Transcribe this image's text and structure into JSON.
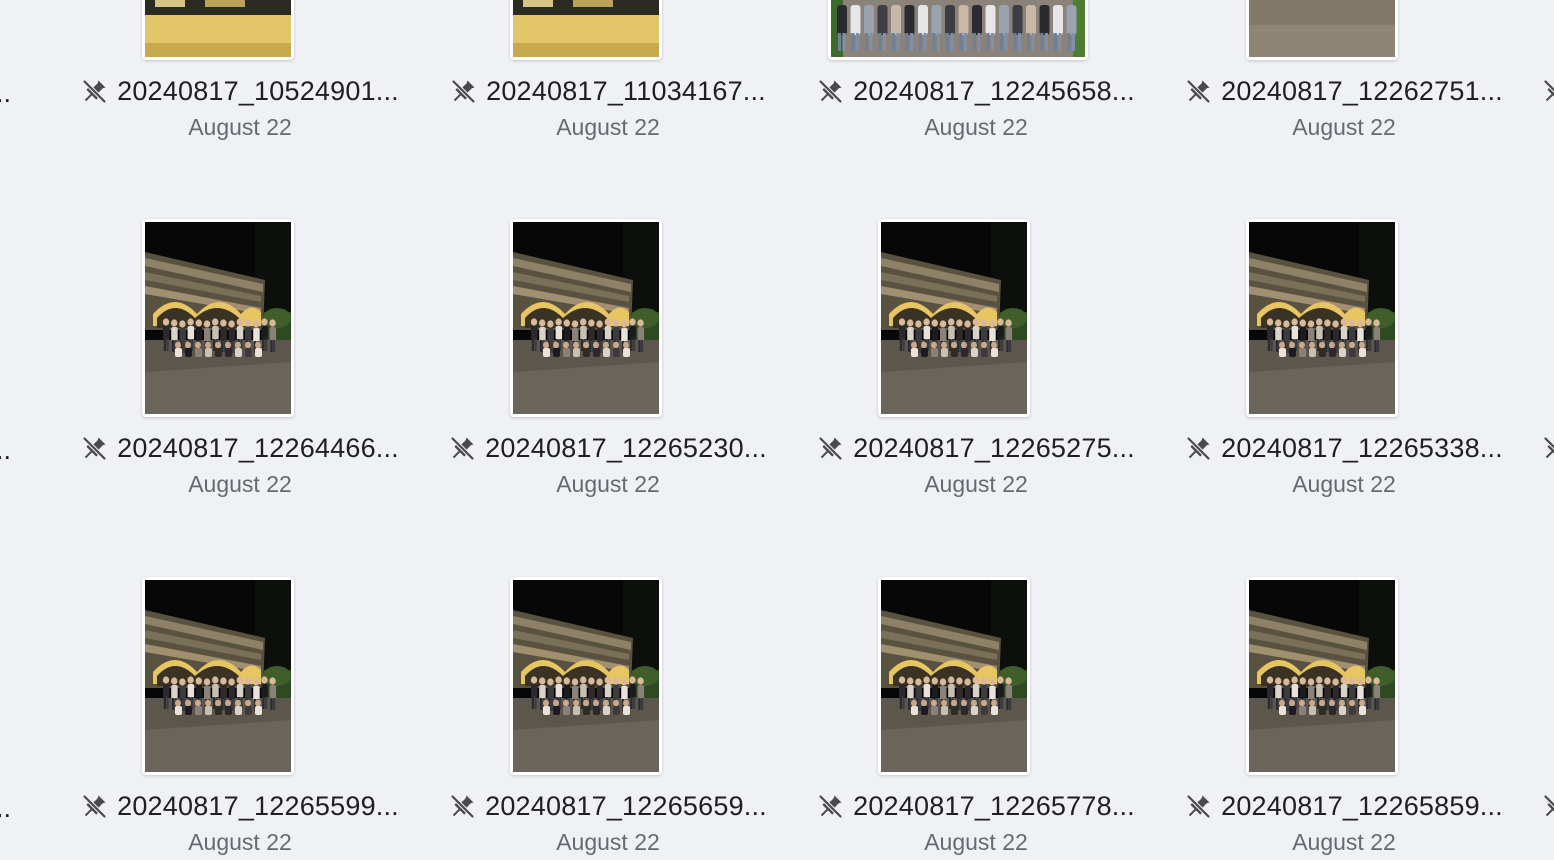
{
  "app": {
    "view": "file-browser-thumbnail-grid"
  },
  "grid": {
    "rows": [
      {
        "items": [
          {
            "name": "20240817_10524901...",
            "date": "August 22",
            "thumb": "building-night"
          },
          {
            "name": "20240817_11034167...",
            "date": "August 22",
            "thumb": "building-night"
          },
          {
            "name": "20240817_12245658...",
            "date": "August 22",
            "thumb": "group-day"
          },
          {
            "name": "20240817_12262751...",
            "date": "August 22",
            "thumb": "pavement"
          }
        ]
      },
      {
        "items": [
          {
            "name": "20240817_12264466...",
            "date": "August 22",
            "thumb": "group-night"
          },
          {
            "name": "20240817_12265230...",
            "date": "August 22",
            "thumb": "group-night"
          },
          {
            "name": "20240817_12265275...",
            "date": "August 22",
            "thumb": "group-night"
          },
          {
            "name": "20240817_12265338...",
            "date": "August 22",
            "thumb": "group-night"
          }
        ]
      },
      {
        "items": [
          {
            "name": "20240817_12265599...",
            "date": "August 22",
            "thumb": "group-night"
          },
          {
            "name": "20240817_12265659...",
            "date": "August 22",
            "thumb": "group-night"
          },
          {
            "name": "20240817_12265778...",
            "date": "August 22",
            "thumb": "group-night"
          },
          {
            "name": "20240817_12265859...",
            "date": "August 22",
            "thumb": "group-night"
          }
        ]
      }
    ]
  },
  "edge": {
    "left_fragment": "..",
    "right_icon": "pin-off-icon"
  },
  "icons": {
    "file_status": "pin-off-icon"
  },
  "colors": {
    "background": "#eff1f5",
    "text_primary": "#1f1f1f",
    "text_secondary": "#666a70",
    "icon": "#4a4a4a"
  }
}
